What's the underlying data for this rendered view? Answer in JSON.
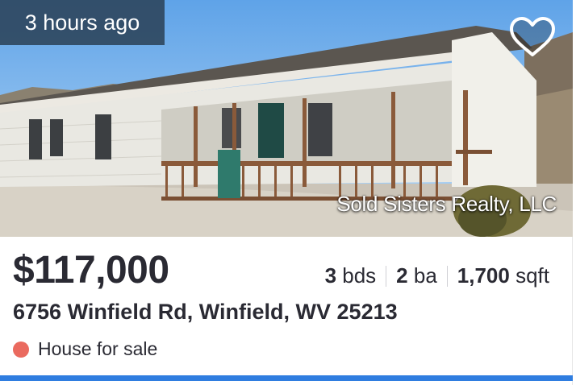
{
  "listing": {
    "time_badge": "3 hours ago",
    "watermark": "Sold Sisters Realty, LLC",
    "price": "$117,000",
    "beds_value": "3",
    "beds_label": "bds",
    "baths_value": "2",
    "baths_label": "ba",
    "sqft_value": "1,700",
    "sqft_label": "sqft",
    "address": "6756 Winfield Rd, Winfield, WV 25213",
    "status": "House for sale"
  },
  "colors": {
    "status_dot": "#ea6a5f",
    "accent_bar": "#2f7de0",
    "badge_bg": "#2f4860",
    "text": "#2a2a33"
  },
  "icons": {
    "favorite": "heart-outline-icon",
    "status": "dot-icon"
  }
}
